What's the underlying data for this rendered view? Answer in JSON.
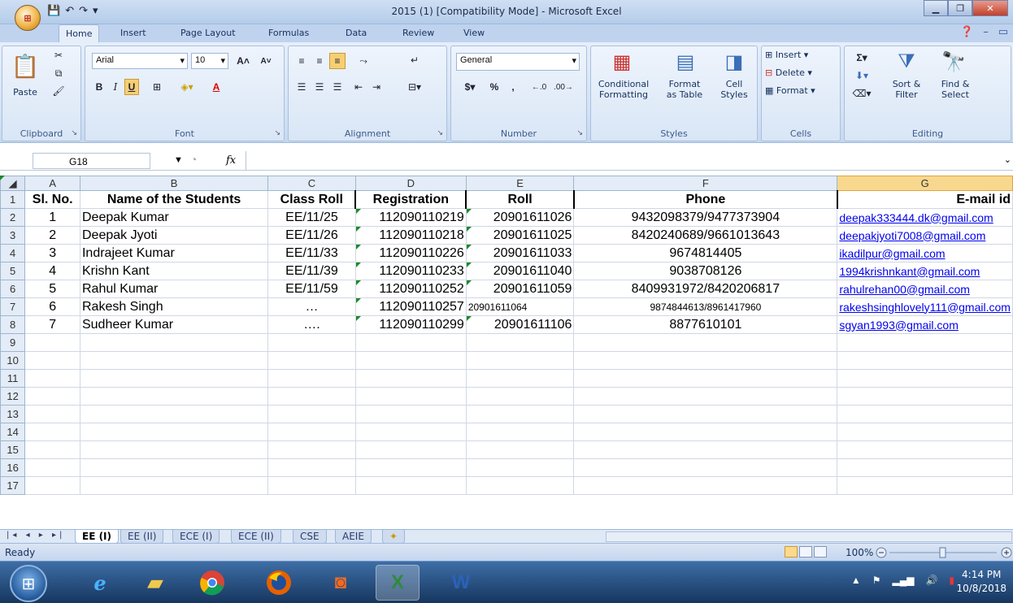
{
  "window": {
    "title": "2015 (1) [Compatibility Mode] - Microsoft Excel",
    "office_button": "Office"
  },
  "ribbon_tabs": [
    "Home",
    "Insert",
    "Page Layout",
    "Formulas",
    "Data",
    "Review",
    "View"
  ],
  "ribbon": {
    "clipboard": {
      "label": "Clipboard",
      "paste": "Paste"
    },
    "font": {
      "label": "Font",
      "name": "Arial",
      "size": "10"
    },
    "alignment": {
      "label": "Alignment"
    },
    "number": {
      "label": "Number",
      "format": "General",
      "currency": "$",
      "percent": "%",
      "comma": ","
    },
    "styles": {
      "label": "Styles",
      "conditional": "Conditional\nFormatting",
      "format_table": "Format\nas Table",
      "cell_styles": "Cell\nStyles"
    },
    "cells": {
      "label": "Cells",
      "insert": "Insert",
      "delete": "Delete",
      "format": "Format"
    },
    "editing": {
      "label": "Editing",
      "sort": "Sort &\nFilter",
      "find": "Find &\nSelect"
    }
  },
  "formula_bar": {
    "name_box": "G18",
    "fx": "fx",
    "content": ""
  },
  "columns": [
    "A",
    "B",
    "C",
    "D",
    "E",
    "F",
    "G"
  ],
  "selected_column": "G",
  "header_row": [
    "Sl. No.",
    "Name of the Students",
    "Class Roll",
    "Registration",
    "Roll",
    "Phone",
    "E-mail id"
  ],
  "rows": [
    {
      "sl": "1",
      "name": "Deepak Kumar",
      "class_roll": "EE/11/25",
      "registration": "112090110219",
      "roll": "20901611026",
      "phone": "9432098379/9477373904",
      "email": "deepak333444.dk@gmail.com"
    },
    {
      "sl": "2",
      "name": "Deepak Jyoti",
      "class_roll": "EE/11/26",
      "registration": "112090110218",
      "roll": "20901611025",
      "phone": "8420240689/9661013643",
      "email": "deepakjyoti7008@gmail.com"
    },
    {
      "sl": "3",
      "name": "Indrajeet Kumar",
      "class_roll": "EE/11/33",
      "registration": "112090110226",
      "roll": "20901611033",
      "phone": "9674814405",
      "email": "ikadilpur@gmail.com"
    },
    {
      "sl": "4",
      "name": "Krishn Kant",
      "class_roll": "EE/11/39",
      "registration": "112090110233",
      "roll": "20901611040",
      "phone": "9038708126",
      "email": "1994krishnkant@gmail.com"
    },
    {
      "sl": "5",
      "name": "Rahul Kumar",
      "class_roll": "EE/11/59",
      "registration": "112090110252",
      "roll": "20901611059",
      "phone": "8409931972/8420206817",
      "email": "rahulrehan00@gmail.com"
    },
    {
      "sl": "6",
      "name": "Rakesh Singh",
      "class_roll": "…",
      "registration": "112090110257",
      "roll": "20901611064",
      "phone": "9874844613/8961417960",
      "email": "rakeshsinghlovely111@gmail.com"
    },
    {
      "sl": "7",
      "name": "Sudheer Kumar",
      "class_roll": "….",
      "registration": "112090110299",
      "roll": "20901611106",
      "phone": "8877610101",
      "email": "sgyan1993@gmail.com"
    }
  ],
  "row_numbers": [
    "1",
    "2",
    "3",
    "4",
    "5",
    "6",
    "7",
    "8",
    "9",
    "10",
    "11",
    "12",
    "13",
    "14",
    "15",
    "16",
    "17"
  ],
  "sheets": [
    "EE (I)",
    "EE (II)",
    "ECE (I)",
    "ECE (II)",
    "CSE",
    "AEIE"
  ],
  "active_sheet": "EE (I)",
  "status": {
    "text": "Ready",
    "zoom": "100%"
  },
  "taskbar": {
    "time": "4:14 PM",
    "date": "10/8/2018"
  }
}
